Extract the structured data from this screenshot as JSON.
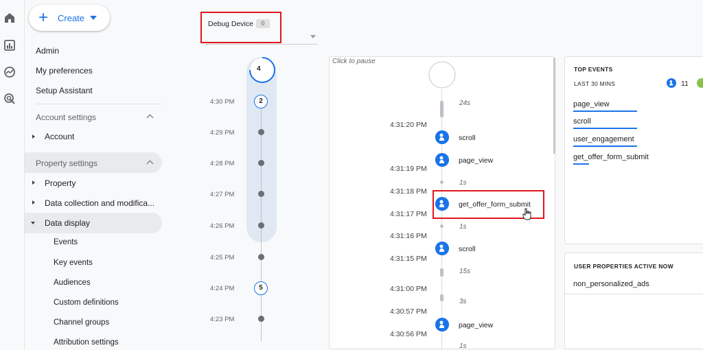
{
  "sidebar": {
    "create_label": "Create",
    "items": {
      "admin": "Admin",
      "my_preferences": "My preferences",
      "setup_assistant": "Setup Assistant",
      "account_settings": "Account settings",
      "account": "Account",
      "property_settings": "Property settings",
      "property": "Property",
      "data_collection": "Data collection and modifica...",
      "data_display": "Data display",
      "events": "Events",
      "key_events": "Key events",
      "audiences": "Audiences",
      "custom_definitions": "Custom definitions",
      "channel_groups": "Channel groups",
      "attribution_settings": "Attribution settings"
    }
  },
  "debug_device": {
    "label": "Debug Device",
    "count": "0"
  },
  "minutes": {
    "badges": [
      "4",
      "2",
      "5"
    ],
    "times": [
      "4:30 PM",
      "4:29 PM",
      "4:28 PM",
      "4:27 PM",
      "4:26 PM",
      "4:25 PM",
      "4:24 PM",
      "4:23 PM"
    ]
  },
  "stream": {
    "click_to_pause": "Click to pause",
    "gaps": [
      "24s",
      "1s",
      "1s",
      "15s",
      "3s",
      "1s"
    ],
    "times": [
      "4:31:20 PM",
      "4:31:19 PM",
      "4:31:18 PM",
      "4:31:17 PM",
      "4:31:16 PM",
      "4:31:15 PM",
      "4:31:00 PM",
      "4:30:57 PM",
      "4:30:56 PM"
    ],
    "events": [
      "scroll",
      "page_view",
      "get_offer_form_submit",
      "scroll",
      "page_view"
    ]
  },
  "top_events": {
    "title": "TOP EVENTS",
    "subtitle": "LAST 30 MINS",
    "user_count": "11",
    "items": [
      {
        "name": "page_view",
        "share": 0.93
      },
      {
        "name": "scroll",
        "share": 0.93
      },
      {
        "name": "user_engagement",
        "share": 0.93
      },
      {
        "name": "get_offer_form_submit",
        "share": 0.23
      }
    ]
  },
  "user_properties": {
    "title": "USER PROPERTIES ACTIVE NOW",
    "items": [
      "non_personalized_ads"
    ]
  },
  "colors": {
    "accent": "#1a73e8",
    "highlight_red": "#e0141b",
    "green": "#8bc34a"
  }
}
